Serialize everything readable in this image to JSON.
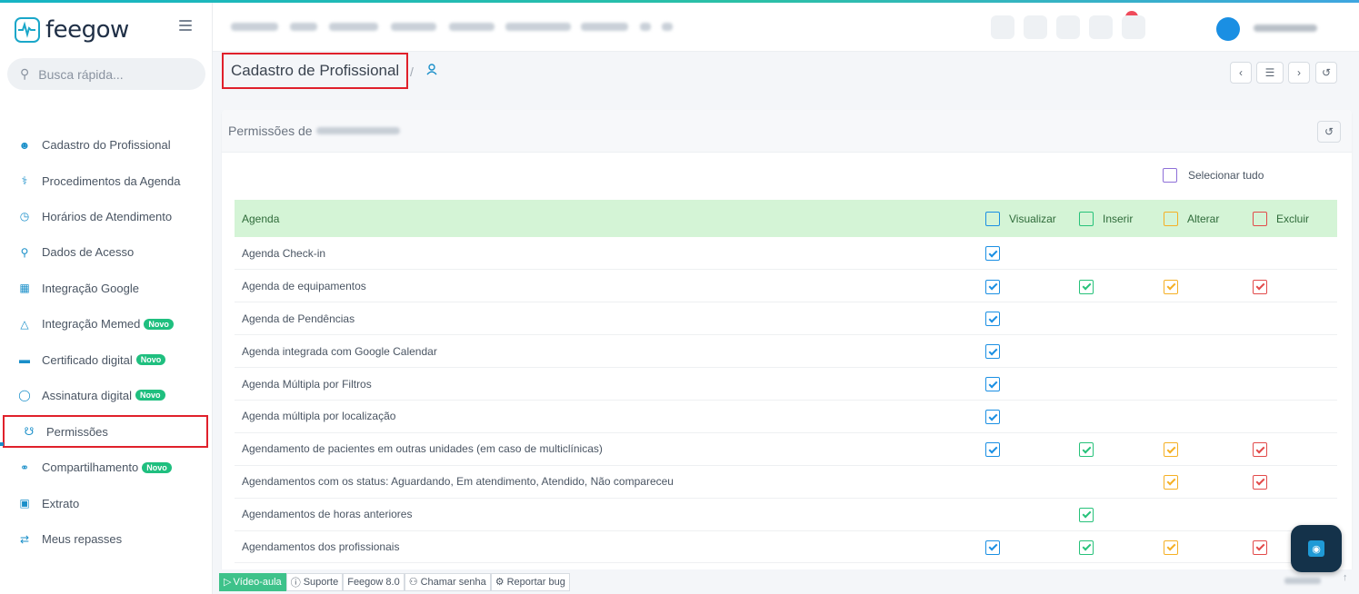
{
  "app": {
    "name": "feegow"
  },
  "search": {
    "placeholder": "Busca rápida..."
  },
  "sidebar": {
    "items": [
      {
        "label": "Cadastro do Profissional",
        "icon": "user-icon",
        "badge": ""
      },
      {
        "label": "Procedimentos da Agenda",
        "icon": "stethoscope-icon",
        "badge": ""
      },
      {
        "label": "Horários de Atendimento",
        "icon": "clock-icon",
        "badge": ""
      },
      {
        "label": "Dados de Acesso",
        "icon": "key-icon",
        "badge": ""
      },
      {
        "label": "Integração Google",
        "icon": "calendar-icon",
        "badge": ""
      },
      {
        "label": "Integração Memed",
        "icon": "flask-icon",
        "badge": "Novo"
      },
      {
        "label": "Certificado digital",
        "icon": "card-icon",
        "badge": "Novo"
      },
      {
        "label": "Assinatura digital",
        "icon": "shield-icon",
        "badge": "Novo"
      },
      {
        "label": "Permissões",
        "icon": "lock-icon",
        "badge": ""
      },
      {
        "label": "Compartilhamento",
        "icon": "share-icon",
        "badge": "Novo"
      },
      {
        "label": "Extrato",
        "icon": "money-icon",
        "badge": ""
      },
      {
        "label": "Meus repasses",
        "icon": "transfer-icon",
        "badge": ""
      }
    ],
    "active_index": 8
  },
  "breadcrumb": {
    "title": "Cadastro de Profissional",
    "separator": "/"
  },
  "panel": {
    "title_prefix": "Permissões de",
    "select_all_label": "Selecionar tudo",
    "section": "Agenda",
    "columns": [
      {
        "label": "Visualizar",
        "color": "#1a8fe3"
      },
      {
        "label": "Inserir",
        "color": "#27c27a"
      },
      {
        "label": "Alterar",
        "color": "#f5b025"
      },
      {
        "label": "Excluir",
        "color": "#e24a4a"
      }
    ],
    "rows": [
      {
        "label": "Agenda Check-in",
        "checks": [
          true,
          null,
          null,
          null
        ]
      },
      {
        "label": "Agenda de equipamentos",
        "checks": [
          true,
          true,
          true,
          true
        ]
      },
      {
        "label": "Agenda de Pendências",
        "checks": [
          true,
          null,
          null,
          null
        ]
      },
      {
        "label": "Agenda integrada com Google Calendar",
        "checks": [
          true,
          null,
          null,
          null
        ]
      },
      {
        "label": "Agenda Múltipla por Filtros",
        "checks": [
          true,
          null,
          null,
          null
        ]
      },
      {
        "label": "Agenda múltipla por localização",
        "checks": [
          true,
          null,
          null,
          null
        ]
      },
      {
        "label": "Agendamento de pacientes em outras unidades (em caso de multiclínicas)",
        "checks": [
          true,
          true,
          true,
          true
        ]
      },
      {
        "label": "Agendamentos com os status: Aguardando, Em atendimento, Atendido, Não compareceu",
        "checks": [
          null,
          null,
          true,
          true
        ]
      },
      {
        "label": "Agendamentos de horas anteriores",
        "checks": [
          null,
          true,
          null,
          null
        ]
      },
      {
        "label": "Agendamentos dos profissionais",
        "checks": [
          true,
          true,
          true,
          true
        ]
      }
    ]
  },
  "footer": {
    "video": "Vídeo-aula",
    "support": "Suporte",
    "version": "Feegow 8.0",
    "call": "Chamar senha",
    "bug": "Reportar bug"
  },
  "colors": {
    "accent": "#1a8fc9",
    "section_bg": "#d4f4d6",
    "highlight": "#e0202b"
  }
}
